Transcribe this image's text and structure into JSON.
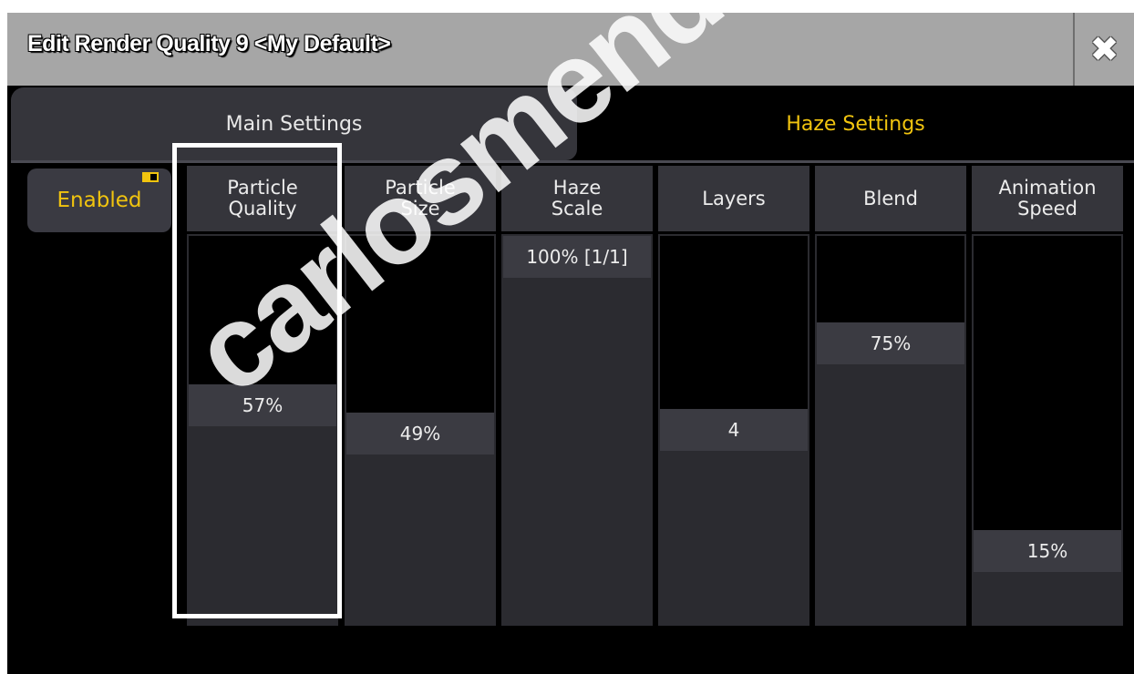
{
  "window": {
    "title": "Edit Render Quality 9 <My Default>",
    "close_icon": "close-x-icon"
  },
  "tabs": [
    {
      "label": "Main Settings",
      "active": false
    },
    {
      "label": "Haze Settings",
      "active": true
    }
  ],
  "enabled_button": {
    "label": "Enabled",
    "state": "on"
  },
  "faders": [
    {
      "header_line1": "Particle",
      "header_line2": "Quality",
      "value_text": "57%",
      "level": 0.57
    },
    {
      "header_line1": "Particle",
      "header_line2": "Size",
      "value_text": "49%",
      "level": 0.49
    },
    {
      "header_line1": "Haze",
      "header_line2": "Scale",
      "value_text": "100% [1/1]",
      "level": 1.0
    },
    {
      "header_line1": "Layers",
      "header_line2": "",
      "value_text": "4",
      "level": 0.5
    },
    {
      "header_line1": "Blend",
      "header_line2": "",
      "value_text": "75%",
      "level": 0.75
    },
    {
      "header_line1": "Animation",
      "header_line2": "Speed",
      "value_text": "15%",
      "level": 0.15
    }
  ],
  "selected_fader": "Particle Quality",
  "watermark": "carlosmendoza",
  "colors": {
    "accent": "#f1c40f",
    "titlebar": "#a6a6a6",
    "panel": "#35353b",
    "background": "#000000"
  }
}
